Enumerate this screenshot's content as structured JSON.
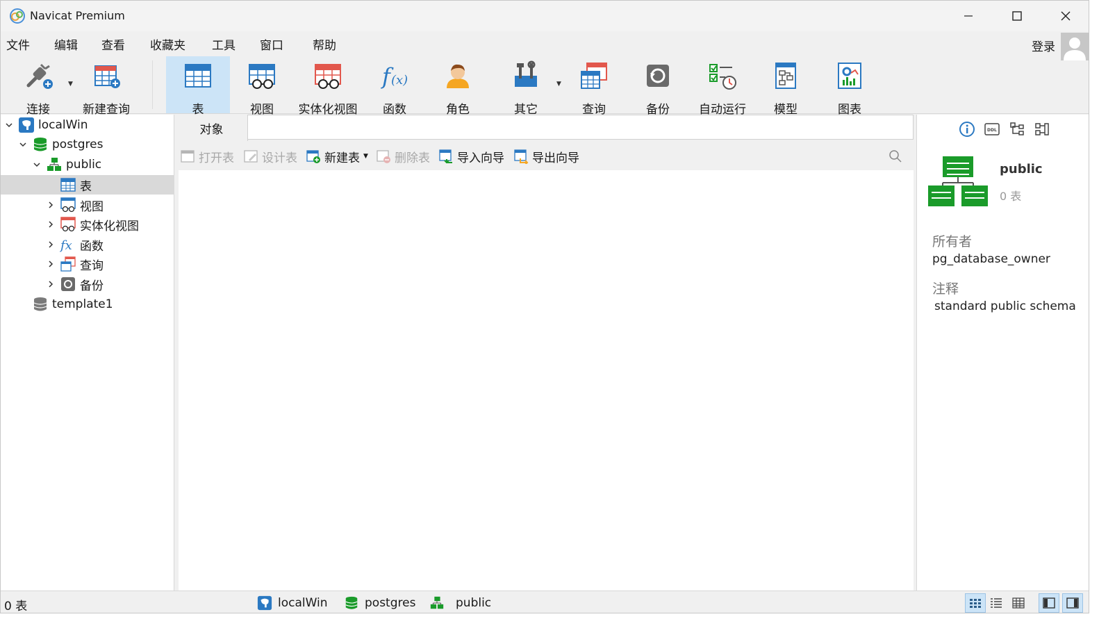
{
  "window": {
    "title": "Navicat Premium"
  },
  "menu": [
    "文件",
    "编辑",
    "查看",
    "收藏夹",
    "工具",
    "窗口",
    "帮助"
  ],
  "account": {
    "login_label": "登录"
  },
  "toolbar": {
    "connect": "连接",
    "new_query": "新建查询",
    "table": "表",
    "view": "视图",
    "materialized_view": "实体化视图",
    "function": "函数",
    "role": "角色",
    "other": "其它",
    "query": "查询",
    "backup": "备份",
    "automation": "自动运行",
    "model": "模型",
    "chart": "图表",
    "active_tool": "表"
  },
  "tree": {
    "connection": "localWin",
    "database": "postgres",
    "schema": "public",
    "items": [
      "表",
      "视图",
      "实体化视图",
      "函数",
      "查询",
      "备份"
    ],
    "selected_item": "表",
    "other_database": "template1"
  },
  "objects": {
    "tab_label": "对象",
    "buttons": {
      "open_table": "打开表",
      "design_table": "设计表",
      "new_table": "新建表",
      "delete_table": "删除表",
      "import_wizard": "导入向导",
      "export_wizard": "导出向导"
    }
  },
  "info": {
    "name": "public",
    "count_text": "0 表",
    "owner_label": "所有者",
    "owner_value": "pg_database_owner",
    "comment_label": "注释",
    "comment_value": "standard public schema"
  },
  "status": {
    "count_text": "0 表",
    "connection": "localWin",
    "database": "postgres",
    "schema": "public"
  },
  "colors": {
    "accent_blue": "#2b79c2",
    "selection": "#cce4f7",
    "schema_green": "#1a9b2a",
    "tree_selected": "#d9d9d9"
  }
}
